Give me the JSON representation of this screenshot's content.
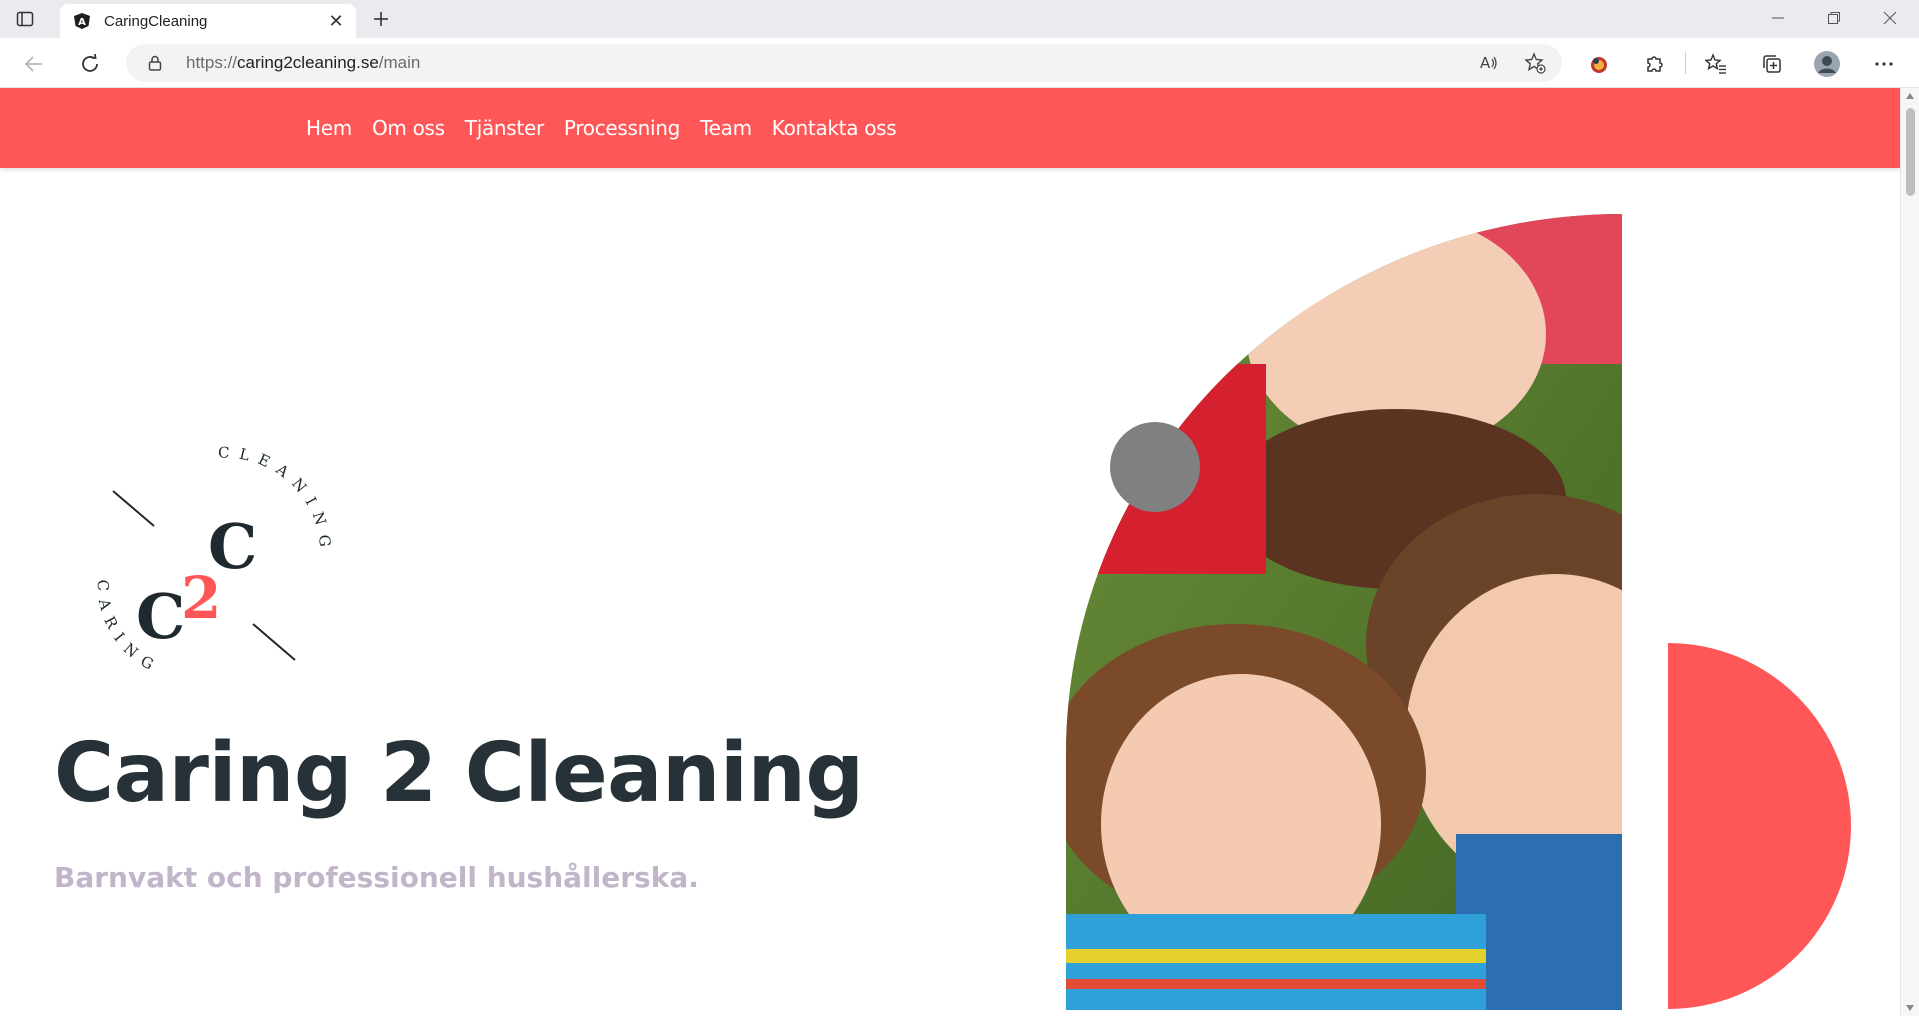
{
  "browser": {
    "tab_title": "CaringCleaning",
    "tab_close": "✕",
    "new_tab": "+",
    "url_scheme": "https://",
    "url_host": "caring2cleaning.se",
    "url_path": "/main",
    "icons": {
      "tab_actions": "tab-actions-icon",
      "favicon": "angular-icon",
      "back": "back-arrow-icon",
      "refresh": "refresh-icon",
      "lock": "lock-icon",
      "read_aloud": "read-aloud-icon",
      "add_favorite": "add-favorite-icon",
      "extension": "extension-icon",
      "extensions": "puzzle-icon",
      "favorites": "favorites-icon",
      "collections": "collections-icon",
      "profile": "profile-avatar",
      "menu": "more-icon"
    }
  },
  "site": {
    "nav": [
      {
        "label": "Hem"
      },
      {
        "label": "Om oss"
      },
      {
        "label": "Tjänster"
      },
      {
        "label": "Processning"
      },
      {
        "label": "Team"
      },
      {
        "label": "Kontakta oss"
      }
    ],
    "logo": {
      "top_word": "CLEANING",
      "bottom_word": "CARING",
      "letter": "C",
      "number": "2"
    },
    "hero": {
      "title": "Caring 2 Cleaning",
      "subtitle": "Barnvakt och professionell hushållerska."
    },
    "colors": {
      "brand_red": "#ff5757",
      "title_dark": "#263238",
      "subtitle_mauve": "#c2b5c9",
      "deco_grey": "#808080"
    }
  }
}
